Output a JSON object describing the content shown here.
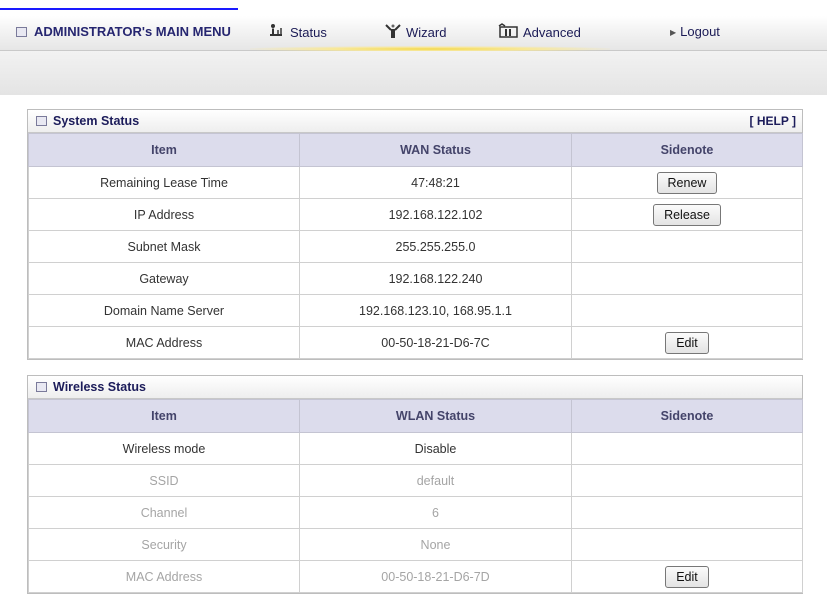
{
  "menu": {
    "admin_label": "ADMINISTRATOR's MAIN MENU",
    "status_label": "Status",
    "wizard_label": "Wizard",
    "advanced_label": "Advanced",
    "logout_label": "Logout"
  },
  "system_status": {
    "title": "System Status",
    "help_label": "[ HELP ]",
    "columns": [
      "Item",
      "WAN Status",
      "Sidenote"
    ],
    "rows": [
      {
        "item": "Remaining Lease Time",
        "value": "47:48:21",
        "button": "Renew"
      },
      {
        "item": "IP Address",
        "value": "192.168.122.102",
        "button": "Release"
      },
      {
        "item": "Subnet Mask",
        "value": "255.255.255.0"
      },
      {
        "item": "Gateway",
        "value": "192.168.122.240"
      },
      {
        "item": "Domain Name Server",
        "value": "192.168.123.10, 168.95.1.1"
      },
      {
        "item": "MAC Address",
        "value": "00-50-18-21-D6-7C",
        "button": "Edit"
      }
    ]
  },
  "wireless_status": {
    "title": "Wireless Status",
    "columns": [
      "Item",
      "WLAN Status",
      "Sidenote"
    ],
    "rows": [
      {
        "item": "Wireless mode",
        "value": "Disable"
      },
      {
        "item": "SSID",
        "value": "default"
      },
      {
        "item": "Channel",
        "value": "6"
      },
      {
        "item": "Security",
        "value": "None"
      },
      {
        "item": "MAC Address",
        "value": "00-50-18-21-D6-7D",
        "button": "Edit"
      }
    ]
  },
  "colors": {
    "header_row": "#dcdcec",
    "menu_text": "#1a1a55",
    "dim_text": "#a5a5a5"
  }
}
